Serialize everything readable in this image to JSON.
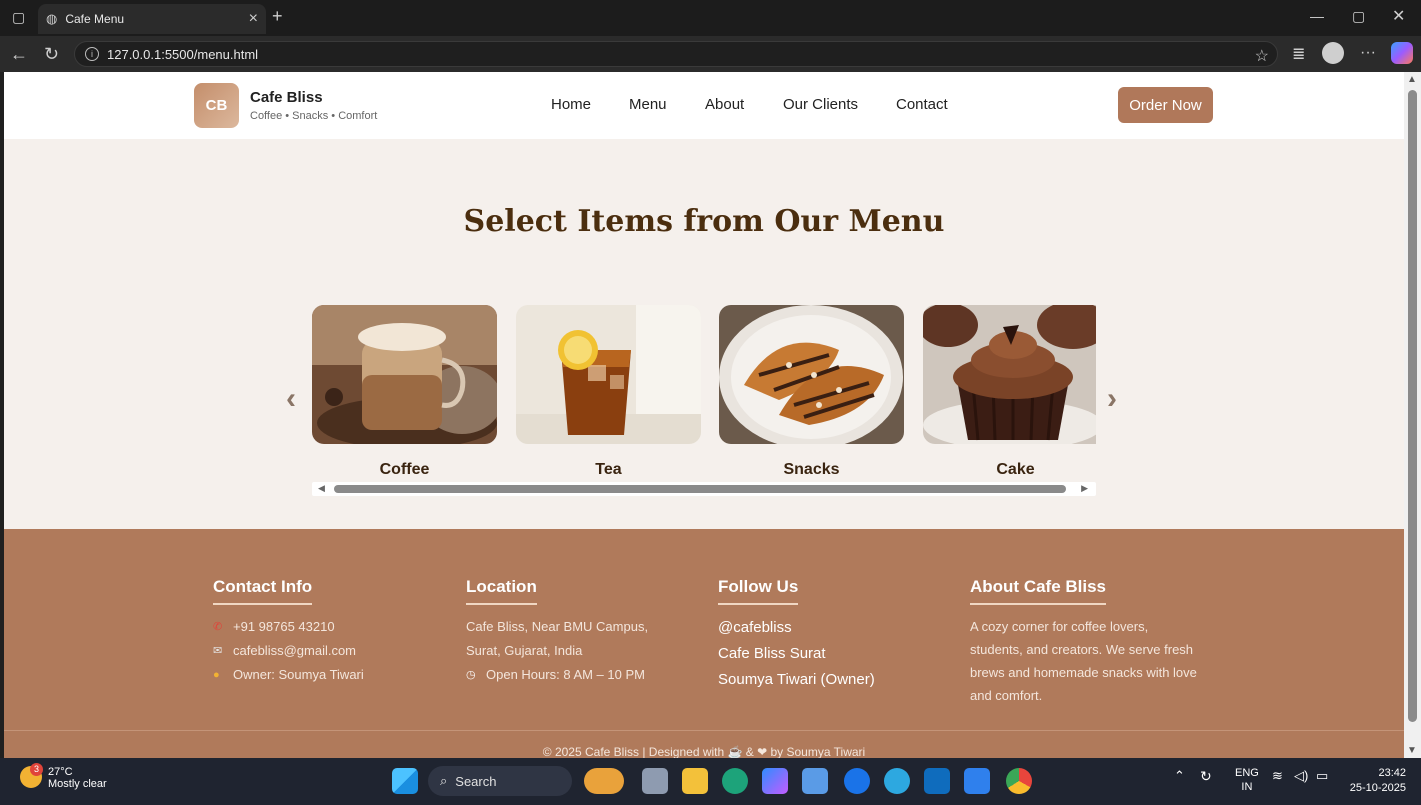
{
  "browser": {
    "tab_title": "Cafe Menu",
    "url": "127.0.0.1:5500/menu.html"
  },
  "header": {
    "logo_initials": "CB",
    "brand_name": "Cafe Bliss",
    "tagline": "Coffee • Snacks • Comfort",
    "nav": [
      "Home",
      "Menu",
      "About",
      "Our Clients",
      "Contact"
    ],
    "cta": "Order Now"
  },
  "menu": {
    "title": "Select Items from Our Menu",
    "items": [
      {
        "label": "Coffee"
      },
      {
        "label": "Tea"
      },
      {
        "label": "Snacks"
      },
      {
        "label": "Cake"
      }
    ]
  },
  "footer": {
    "contact": {
      "heading": "Contact Info",
      "phone": "+91 98765 43210",
      "email": "cafebliss@gmail.com",
      "owner": "Owner: Soumya Tiwari"
    },
    "location": {
      "heading": "Location",
      "line1": "Cafe Bliss, Near BMU Campus,",
      "line2": "Surat, Gujarat, India",
      "hours": "Open Hours: 8 AM – 10 PM"
    },
    "follow": {
      "heading": "Follow Us",
      "links": [
        "@cafebliss",
        "Cafe Bliss Surat",
        "Soumya Tiwari (Owner)"
      ]
    },
    "about": {
      "heading": "About Cafe Bliss",
      "text": "A cozy corner for coffee lovers, students, and creators. We serve fresh brews and homemade snacks with love and comfort."
    },
    "copyright": "© 2025 Cafe Bliss | Designed with ☕ & ❤ by Soumya Tiwari"
  },
  "taskbar": {
    "temp": "27°C",
    "weather": "Mostly clear",
    "weather_badge": "3",
    "search": "Search",
    "lang_top": "ENG",
    "lang_bottom": "IN",
    "time": "23:42",
    "date": "25-10-2025"
  },
  "colors": {
    "brand": "#b0785a",
    "title": "#4b2e0f",
    "page_bg": "#f5f0ec"
  }
}
